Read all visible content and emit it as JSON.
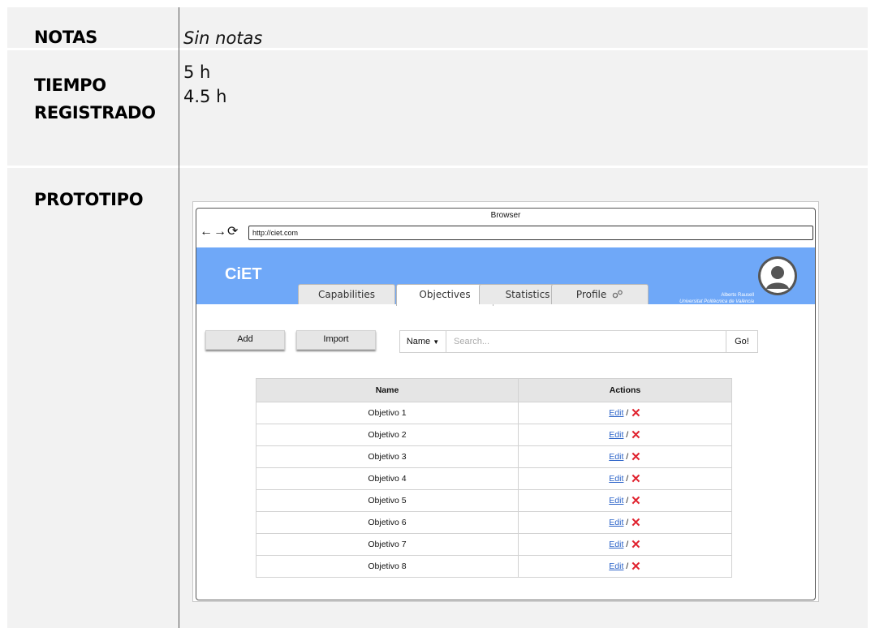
{
  "notas": {
    "label": "NOTAS",
    "value": "Sin notas"
  },
  "tiempo": {
    "label_line1": "TIEMPO",
    "label_line2": "REGISTRADO",
    "values": [
      "5 h",
      "4.5 h"
    ]
  },
  "prototipo": {
    "label": "PROTOTIPO",
    "browser": {
      "title": "Browser",
      "url": "http://ciet.com",
      "nav_back": "←",
      "nav_forward": "→",
      "nav_reload": "⟳"
    },
    "app": {
      "brand": "CiET",
      "tabs": [
        "Capabilities",
        "Objectives",
        "Statistics",
        "Profile"
      ],
      "active_tab": "Objectives",
      "profile_icon": "gears-icon",
      "user_name": "Alberto Rausell",
      "user_org": "Universitat Politècnica de València",
      "header_color": "#6fa8f8",
      "buttons": {
        "add": "Add",
        "import": "Import"
      },
      "search": {
        "select_label": "Name",
        "placeholder": "Search...",
        "go": "Go!"
      },
      "table": {
        "headers": [
          "Name",
          "Actions"
        ],
        "rows": [
          "Objetivo 1",
          "Objetivo 2",
          "Objetivo 3",
          "Objetivo 4",
          "Objetivo 5",
          "Objetivo 6",
          "Objetivo 7",
          "Objetivo 8"
        ],
        "edit_label": "Edit",
        "separator": "/",
        "delete_glyph": "✕"
      }
    }
  }
}
